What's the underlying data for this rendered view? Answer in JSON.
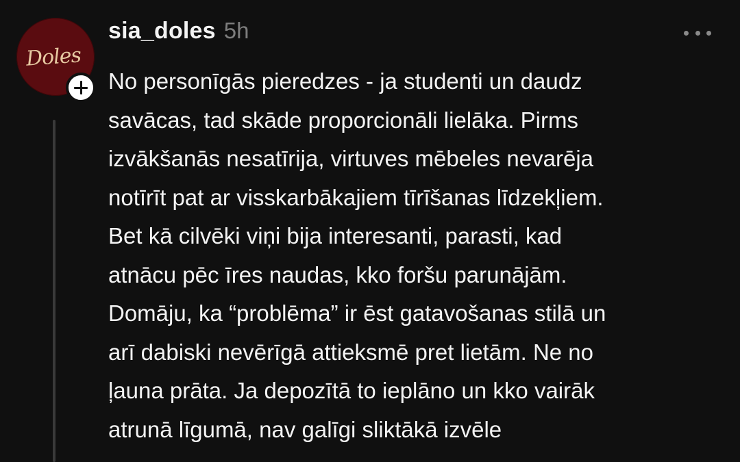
{
  "post": {
    "username": "sia_doles",
    "timestamp": "5h",
    "avatar_text": "Doles",
    "colors": {
      "background": "#101010",
      "avatar": "#5a0c10",
      "text": "#f3f3f3",
      "muted": "#7d7d7d",
      "thread_line": "#3a3a3a"
    },
    "icons": {
      "follow": "plus-icon",
      "more": "more-horizontal-icon"
    },
    "body_lines": [
      "No personīgās pieredzes - ja studenti un daudz",
      "savācas, tad skāde proporcionāli lielāka. Pirms",
      "izvākšanās nesatīrija, virtuves mēbeles nevarēja",
      "notīrīt pat ar visskarbākajiem tīrīšanas līdzekļiem.",
      "Bet kā cilvēki viņi bija interesanti, parasti, kad",
      "atnācu pēc īres naudas, kko foršu parunājām.",
      "Domāju, ka “problēma” ir ēst gatavošanas stilā un",
      "arī dabiski nevērīgā attieksmē pret lietām. Ne no",
      "ļauna prāta. Ja depozītā to ieplāno un kko vairāk",
      "atrunā līgumā, nav galīgi sliktākā izvēle"
    ]
  }
}
